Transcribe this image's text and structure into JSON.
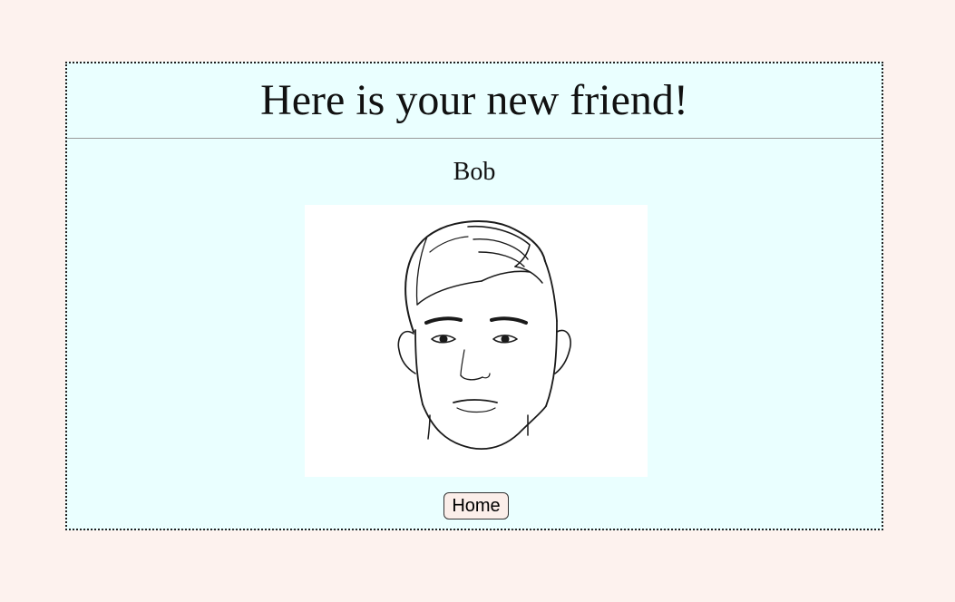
{
  "page": {
    "heading": "Here is your new friend!",
    "friend_name": "Bob",
    "portrait_alt": "portrait sketch of a man",
    "home_label": "Home"
  },
  "colors": {
    "page_background": "#fdf2ee",
    "card_background": "#eaffff",
    "button_background": "#fbeee9"
  }
}
